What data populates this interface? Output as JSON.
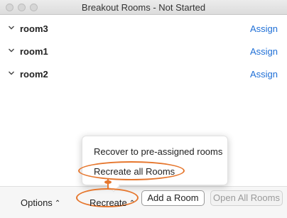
{
  "window": {
    "title": "Breakout Rooms - Not Started"
  },
  "rooms": [
    {
      "name": "room3",
      "action": "Assign"
    },
    {
      "name": "room1",
      "action": "Assign"
    },
    {
      "name": "room2",
      "action": "Assign"
    }
  ],
  "popup": {
    "items": [
      {
        "label": "Recover to pre-assigned rooms"
      },
      {
        "label": "Recreate all Rooms"
      }
    ]
  },
  "footer": {
    "options_label": "Options",
    "recreate_label": "Recreate",
    "caret_icon": "chevron-up-icon",
    "add_room_label": "Add a Room",
    "open_all_label": "Open All Rooms"
  },
  "colors": {
    "link": "#1f6fd6",
    "highlight": "#e6772e"
  }
}
